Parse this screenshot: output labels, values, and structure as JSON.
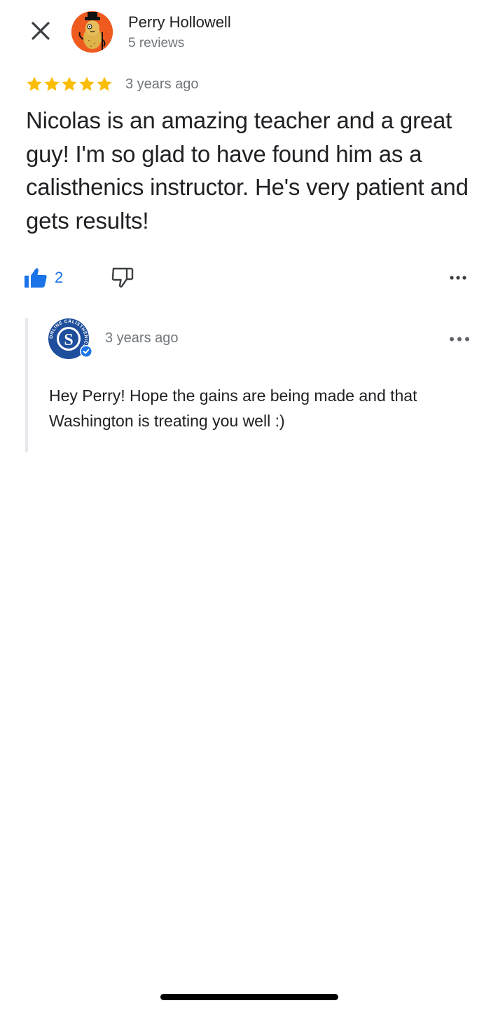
{
  "header": {
    "user_name": "Perry Hollowell",
    "review_count": "5 reviews"
  },
  "review": {
    "rating": 5,
    "rating_max": 5,
    "date": "3 years ago",
    "text": "Nicolas is an amazing teacher and a great guy! I'm so glad to have found him as a calisthenics instructor. He's very patient and gets results!",
    "like_count": "2"
  },
  "reply": {
    "owner_logo_text": "ONLINE CALISTHENICS",
    "date": "3 years ago",
    "text": "Hey Perry! Hope the gains are being made and that Washington is treating you well :)"
  },
  "colors": {
    "star": "#fbbc04",
    "accent": "#1a73e8",
    "secondary_text": "#70757a",
    "avatar_bg": "#ef5b1f",
    "logo_blue": "#1f4e9c"
  },
  "icons": {
    "close": "close-icon",
    "like": "thumb-up-icon",
    "dislike": "thumb-down-icon",
    "more": "more-horiz-icon",
    "verified": "verified-badge-icon"
  }
}
